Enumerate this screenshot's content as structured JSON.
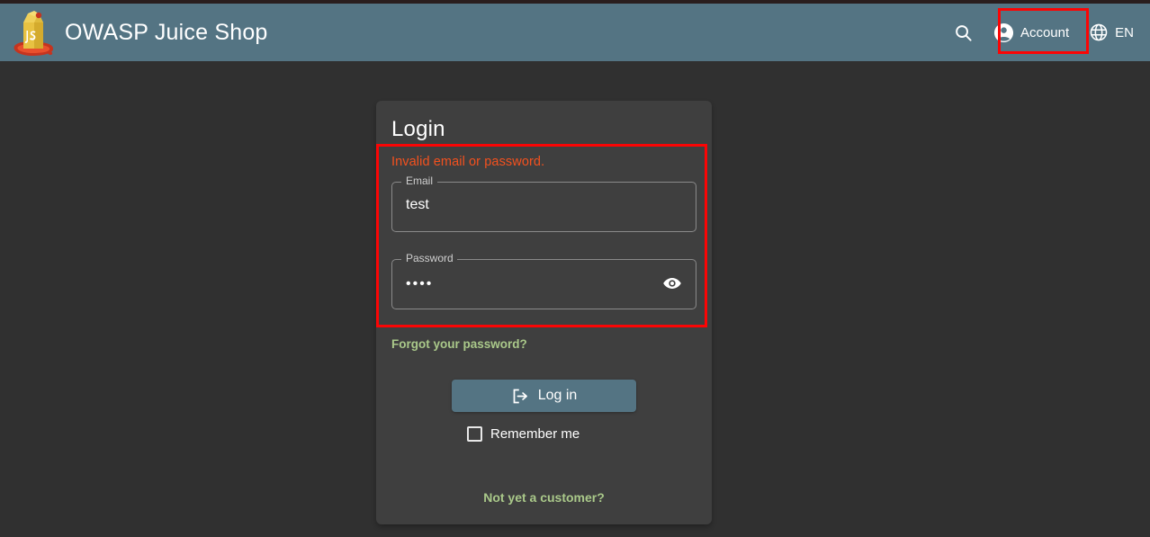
{
  "app": {
    "title": "OWASP Juice Shop",
    "logo_icon": "juice-box-logo-icon"
  },
  "toolbar": {
    "search_icon": "search-icon",
    "account_label": "Account",
    "account_icon": "account-circle-icon",
    "language_label": "EN",
    "language_icon": "globe-icon",
    "accent_color": "#547483"
  },
  "annotations": {
    "highlight_color": "#fb0505",
    "account_box_label": "account-button-highlight",
    "form_box_label": "login-form-highlight"
  },
  "login": {
    "title": "Login",
    "error": "Invalid email or password.",
    "error_color": "#f4511e",
    "email": {
      "label": "Email",
      "value": "test",
      "placeholder": "Email"
    },
    "password": {
      "label": "Password",
      "value": "••••",
      "placeholder": "Password",
      "visibility_icon": "eye-icon"
    },
    "forgot_link": "Forgot your password?",
    "submit_label": "Log in",
    "submit_icon": "login-arrow-icon",
    "remember_label": "Remember me",
    "remember_checked": false,
    "signup_link": "Not yet a customer?",
    "link_color": "#aac98a"
  }
}
